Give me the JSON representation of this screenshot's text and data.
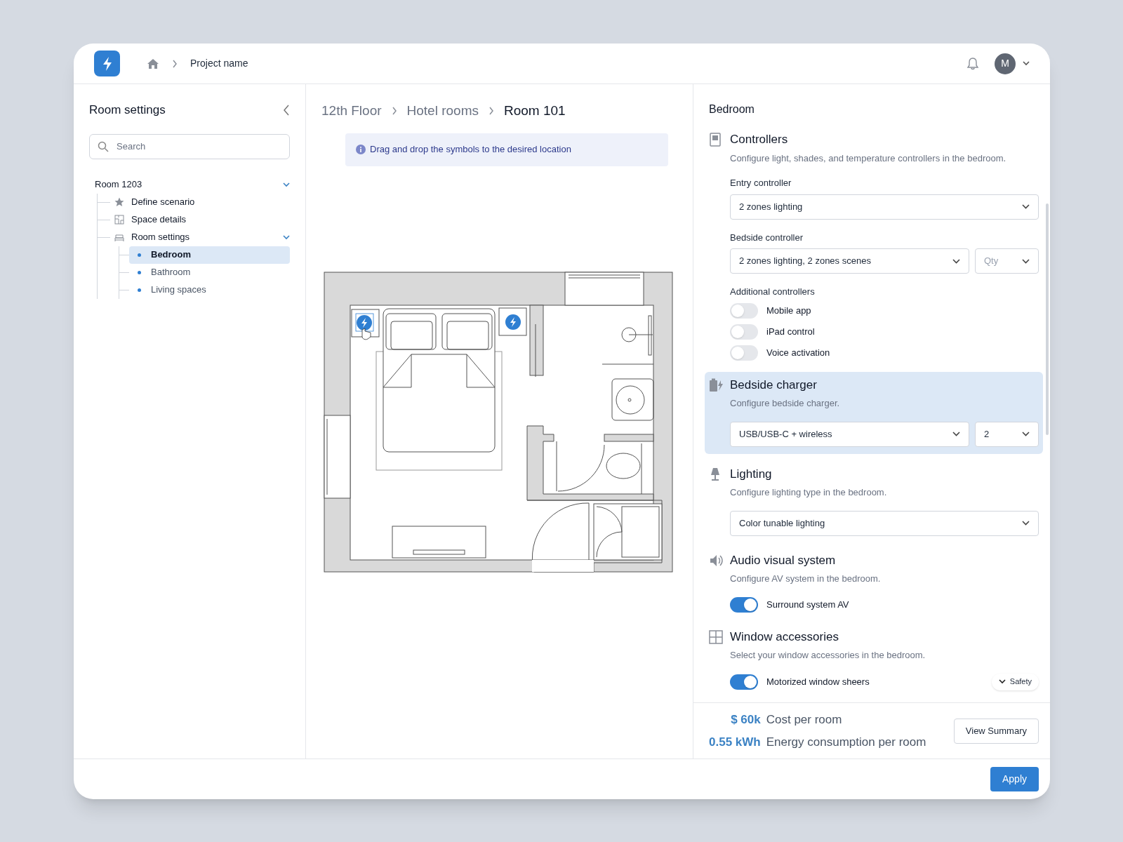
{
  "header": {
    "breadcrumb": "Project name",
    "avatar": "M"
  },
  "sidebar": {
    "title": "Room settings",
    "search": {
      "placeholder": "Search"
    },
    "tree": [
      {
        "label": "Room 1203",
        "expanded": true,
        "children": [
          {
            "label": "Define scenario"
          },
          {
            "label": "Space details"
          },
          {
            "label": "Room settings",
            "expanded": true,
            "children": [
              {
                "label": "Bedroom",
                "selected": true
              },
              {
                "label": "Bathroom",
                "selected": false
              },
              {
                "label": "Living spaces",
                "selected": false
              }
            ]
          }
        ]
      }
    ]
  },
  "canvas": {
    "breadcrumb": [
      "12th Floor",
      "Hotel rooms",
      "Room 101"
    ],
    "hint": "Drag and drop the symbols to the desired location"
  },
  "panel": {
    "title": "Bedroom",
    "sections": [
      {
        "title": "Controllers",
        "description": "Configure light, shades, and temperature controllers in the bedroom.",
        "highlighted": false,
        "fields": [
          {
            "kind": "select",
            "label": "Entry controller",
            "value": "2 zones lighting"
          },
          {
            "kind": "select_pair",
            "label": "Bedside controller",
            "value": "2 zones lighting, 2 zones scenes",
            "qty": {
              "placeholder": "Qty"
            }
          },
          {
            "kind": "toggles",
            "label": "Additional controllers",
            "items": [
              {
                "label": "Mobile app",
                "on": false
              },
              {
                "label": "iPad control",
                "on": false
              },
              {
                "label": "Voice activation",
                "on": false
              }
            ]
          }
        ]
      },
      {
        "title": "Bedside charger",
        "description": "Configure bedside charger.",
        "highlighted": true,
        "fields": [
          {
            "kind": "select_pair",
            "value": "USB/USB-C + wireless",
            "qty": {
              "value": "2"
            }
          }
        ]
      },
      {
        "title": "Lighting",
        "description": "Configure lighting type in the bedroom.",
        "highlighted": false,
        "fields": [
          {
            "kind": "select",
            "value": "Color tunable lighting"
          }
        ]
      },
      {
        "title": "Audio visual system",
        "description": "Configure AV system in the bedroom.",
        "highlighted": false,
        "fields": [
          {
            "kind": "toggles",
            "items": [
              {
                "label": "Surround system AV",
                "on": true
              }
            ]
          }
        ]
      },
      {
        "title": "Window accessories",
        "description": "Select your window accessories in the bedroom.",
        "highlighted": false,
        "fields": [
          {
            "kind": "toggles",
            "items": [
              {
                "label": "Motorized window sheers",
                "on": true
              }
            ]
          }
        ]
      }
    ],
    "safety": "Safety",
    "summary": [
      {
        "value": "$ 60k",
        "label": "Cost per room"
      },
      {
        "value": "0.55 kWh",
        "label": "Energy consumption per room"
      }
    ],
    "summary_button": "View Summary"
  },
  "apply_button": "Apply"
}
